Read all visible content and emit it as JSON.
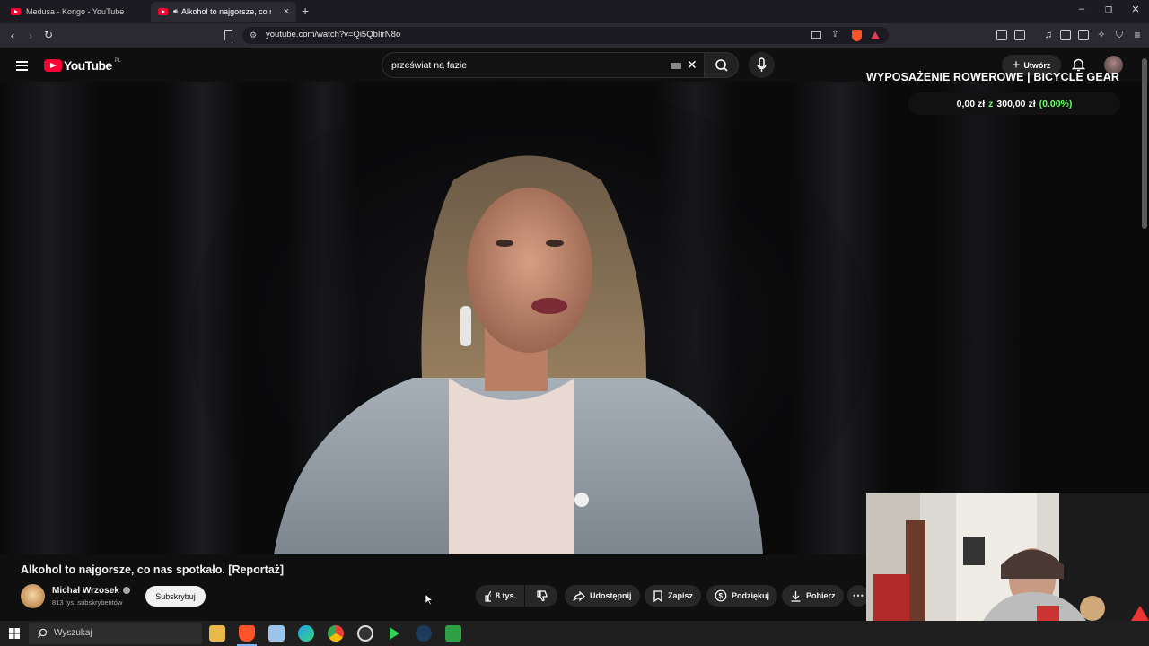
{
  "browser": {
    "tabs": [
      {
        "label": "Medusa - Kongo - YouTube",
        "active": false
      },
      {
        "label": "Alkohol to najgorsze, co nas s",
        "active": true
      }
    ],
    "url": "youtube.com/watch?v=Qi5QbIirN8o"
  },
  "youtube": {
    "logo_text": "YouTube",
    "region": "PL",
    "search_query": "przeświat na fazie",
    "create_label": "Utwórz"
  },
  "overlay": {
    "goal_title": "WYPOSAŻENIE ROWEROWE | BICYCLE GEAR",
    "goal_amount": "0,00 zł",
    "goal_of": "z",
    "goal_target": "300,00 zł",
    "goal_percent": "(0.00%)",
    "goal_progress": 0
  },
  "video": {
    "title": "Alkohol to najgorsze, co nas spotkało. [Reportaż]",
    "channel_name": "Michał Wrzosek",
    "subscribers": "813 tys. subskrybentów",
    "subscribe_label": "Subskrybuj",
    "likes": "8 tys.",
    "share_label": "Udostępnij",
    "save_label": "Zapisz",
    "thanks_label": "Podziękuj",
    "download_label": "Pobierz"
  },
  "taskbar": {
    "search_placeholder": "Wyszukaj"
  },
  "colors": {
    "youtube_red": "#ff0033",
    "goal_percent_green": "#6bff6b",
    "background": "#0f0f0f"
  }
}
